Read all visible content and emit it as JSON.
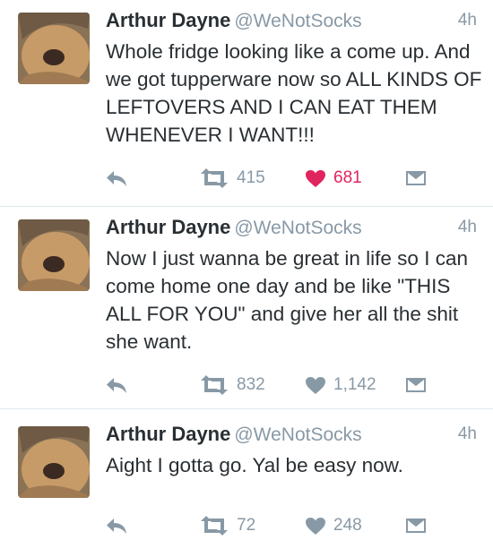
{
  "tweets": [
    {
      "name": "Arthur Dayne",
      "handle": "@WeNotSocks",
      "time": "4h",
      "text": "Whole fridge looking like a come up. And we got tupperware now so ALL KINDS OF LEFTOVERS AND I CAN EAT THEM WHENEVER I WANT!!!",
      "retweets": "415",
      "likes": "681",
      "liked": true
    },
    {
      "name": "Arthur Dayne",
      "handle": "@WeNotSocks",
      "time": "4h",
      "text": "Now I just wanna be great in life so I can come home one day and be like \"THIS ALL FOR YOU\" and give her all the shit she want.",
      "retweets": "832",
      "likes": "1,142",
      "liked": false
    },
    {
      "name": "Arthur Dayne",
      "handle": "@WeNotSocks",
      "time": "4h",
      "text": "Aight I gotta go. Yal be easy now.",
      "retweets": "72",
      "likes": "248",
      "liked": false
    }
  ],
  "colors": {
    "text": "#292f33",
    "secondary": "#8899a6",
    "like_active": "#e0245e",
    "divider": "#e1e8ed"
  },
  "icons": [
    "reply-icon",
    "retweet-icon",
    "heart-icon",
    "dm-envelope-icon"
  ]
}
